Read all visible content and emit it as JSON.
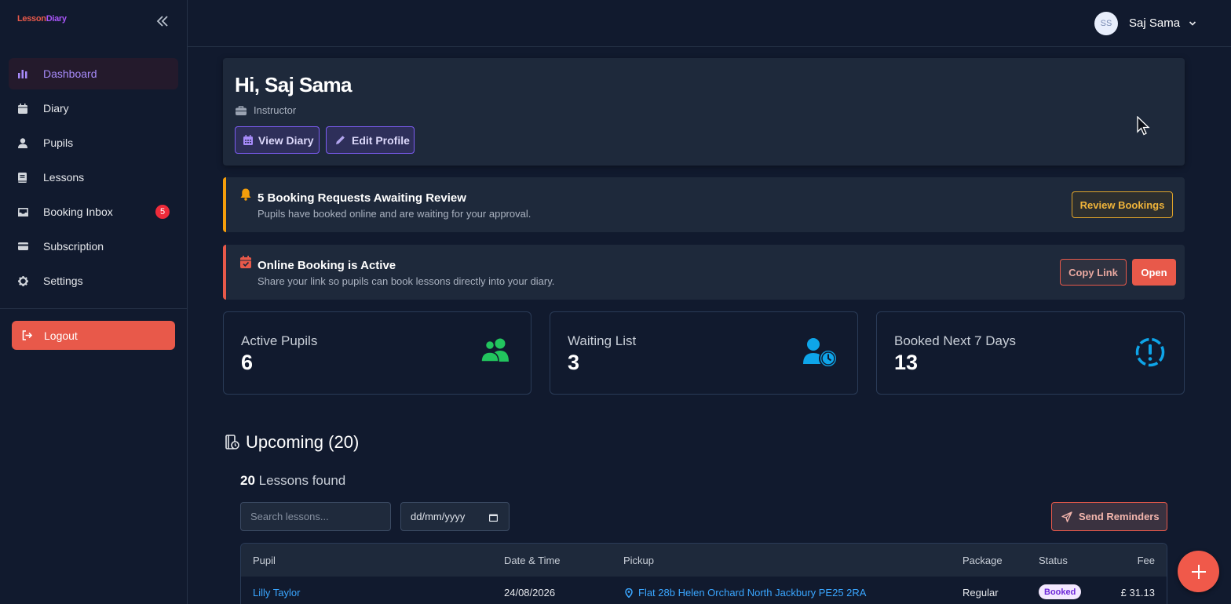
{
  "app": {
    "logo_part1": "Lesson",
    "logo_part2": "Diary"
  },
  "sidebar": {
    "items": [
      {
        "label": "Dashboard",
        "icon": "chart-bar-icon",
        "active": true
      },
      {
        "label": "Diary",
        "icon": "calendar-icon"
      },
      {
        "label": "Pupils",
        "icon": "user-icon"
      },
      {
        "label": "Lessons",
        "icon": "book-icon"
      },
      {
        "label": "Booking Inbox",
        "icon": "inbox-icon",
        "badge": "5"
      },
      {
        "label": "Subscription",
        "icon": "credit-card-icon"
      },
      {
        "label": "Settings",
        "icon": "gear-icon"
      }
    ],
    "logout_label": "Logout"
  },
  "user": {
    "initials": "SS",
    "name": "Saj Sama"
  },
  "welcome": {
    "greeting": "Hi, Saj Sama",
    "role": "Instructor",
    "view_diary_label": "View Diary",
    "edit_profile_label": "Edit Profile"
  },
  "alerts": {
    "booking_requests": {
      "title": "5 Booking Requests Awaiting Review",
      "subtitle": "Pupils have booked online and are waiting for your approval.",
      "button": "Review Bookings"
    },
    "online_booking": {
      "title": "Online Booking is Active",
      "subtitle": "Share your link so pupils can book lessons directly into your diary.",
      "copy_button": "Copy Link",
      "open_button": "Open"
    }
  },
  "stats": [
    {
      "label": "Active Pupils",
      "value": "6",
      "icon": "users-icon",
      "color": "#22c55e"
    },
    {
      "label": "Waiting List",
      "value": "3",
      "icon": "user-clock-icon",
      "color": "#0ea5e9"
    },
    {
      "label": "Booked Next 7 Days",
      "value": "13",
      "icon": "alert-circle-icon",
      "color": "#0ea5e9"
    }
  ],
  "upcoming": {
    "title": "Upcoming (20)",
    "count": "20",
    "count_suffix": "Lessons found",
    "search_placeholder": "Search lessons...",
    "date_placeholder": "dd/mm/yyyy",
    "send_reminders_label": "Send Reminders",
    "columns": [
      "Pupil",
      "Date & Time",
      "Pickup",
      "Package",
      "Status",
      "Fee"
    ],
    "rows": [
      {
        "pupil": "Lilly Taylor",
        "date": "24/08/2026",
        "pickup": "Flat 28b Helen Orchard North Jackbury PE25 2RA",
        "package": "Regular",
        "status": "Booked",
        "fee": "£ 31.13"
      }
    ]
  },
  "colors": {
    "accent": "#e8594a",
    "purple": "#a78bfa",
    "link": "#3aa6ff",
    "warning": "#f59e0b"
  }
}
